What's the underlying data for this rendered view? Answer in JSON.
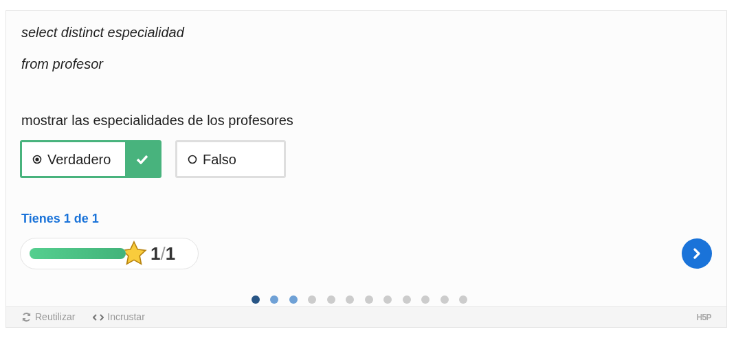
{
  "question": {
    "code_lines": [
      "select distinct especialidad",
      "from profesor"
    ],
    "statement": "mostrar las especialidades de los profesores"
  },
  "answers": [
    {
      "label": "Verdadero",
      "selected": true
    },
    {
      "label": "Falso",
      "selected": false
    }
  ],
  "feedback": "Tienes 1 de 1",
  "score": {
    "level": 1,
    "value": "1",
    "separator": "/",
    "max": "1"
  },
  "pager": [
    {
      "selected": true,
      "answered": true
    },
    {
      "selected": false,
      "answered": true
    },
    {
      "selected": false,
      "answered": true
    },
    {
      "selected": false,
      "answered": false
    },
    {
      "selected": false,
      "answered": false
    },
    {
      "selected": false,
      "answered": false
    },
    {
      "selected": false,
      "answered": false
    },
    {
      "selected": false,
      "answered": false
    },
    {
      "selected": false,
      "answered": false
    },
    {
      "selected": false,
      "answered": false
    },
    {
      "selected": false,
      "answered": false
    },
    {
      "selected": false,
      "answered": false
    }
  ],
  "footer": {
    "actions": [
      {
        "kind": "reuse",
        "label": "Reutilizar"
      },
      {
        "kind": "embed",
        "label": "Incrustar"
      }
    ],
    "logo": "H5P"
  }
}
